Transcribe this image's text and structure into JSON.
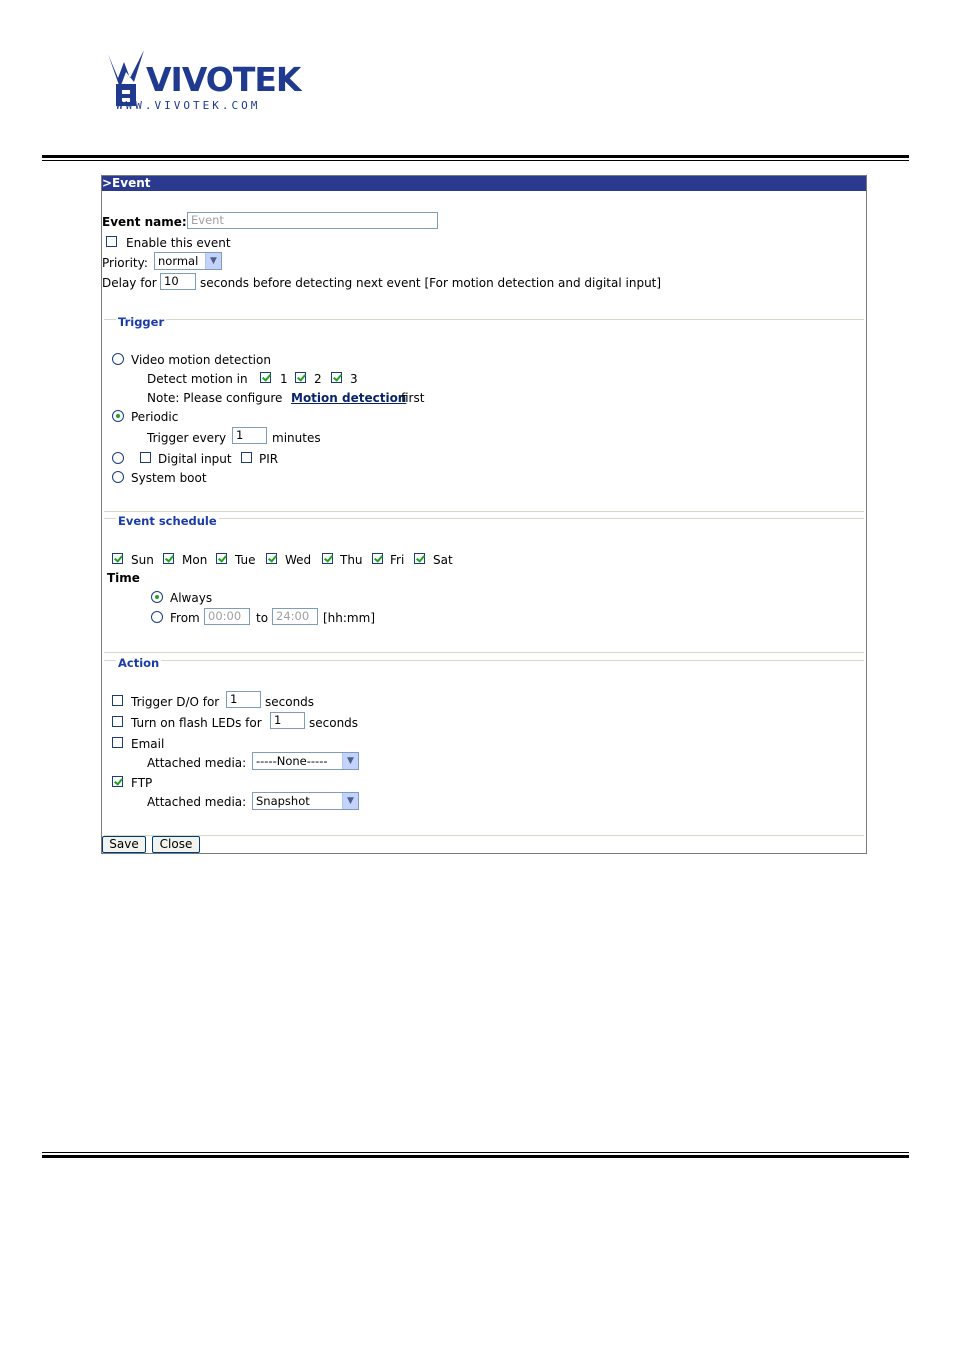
{
  "logo": {
    "brand": "VIVOTEK",
    "url": "WWW.VIVOTEK.COM"
  },
  "panel": {
    "title": ">Event",
    "event_name": {
      "label": "Event name:",
      "value": "Event"
    },
    "enable": {
      "label": "Enable this event",
      "checked": false
    },
    "priority": {
      "label": "Priority:",
      "value": "normal"
    },
    "delay": {
      "label": "Delay for",
      "value": "10",
      "suffix": "seconds before detecting next event [For motion detection and digital input]"
    }
  },
  "trigger": {
    "legend": "Trigger",
    "video_motion": {
      "label": "Video motion detection",
      "selected": false
    },
    "detect_label": "Detect motion in",
    "windows": [
      {
        "label": "1",
        "checked": true
      },
      {
        "label": "2",
        "checked": true
      },
      {
        "label": "3",
        "checked": true
      }
    ],
    "note_prefix": "Note: Please configure",
    "note_link": "Motion detection",
    "note_suffix": "first",
    "periodic": {
      "label": "Periodic",
      "selected": true
    },
    "trigger_every_label": "Trigger every",
    "trigger_every_value": "1",
    "minutes_label": "minutes",
    "digital_input": {
      "label": "Digital input",
      "checked": false
    },
    "pir": {
      "label": "PIR",
      "checked": false
    },
    "system_boot": {
      "label": "System boot",
      "selected": false
    }
  },
  "schedule": {
    "legend": "Event schedule",
    "days": [
      {
        "label": "Sun",
        "checked": true
      },
      {
        "label": "Mon",
        "checked": true
      },
      {
        "label": "Tue",
        "checked": true
      },
      {
        "label": "Wed",
        "checked": true
      },
      {
        "label": "Thu",
        "checked": true
      },
      {
        "label": "Fri",
        "checked": true
      },
      {
        "label": "Sat",
        "checked": true
      }
    ],
    "time_label": "Time",
    "always_label": "Always",
    "from_label": "From",
    "from_value": "00:00",
    "to_label": "to",
    "to_value": "24:00",
    "format_hint": "[hh:mm]"
  },
  "action": {
    "legend": "Action",
    "trigger_do": {
      "label": "Trigger D/O for",
      "value": "1",
      "suffix": "seconds",
      "checked": false
    },
    "flash_leds": {
      "label": "Turn on flash LEDs for",
      "value": "1",
      "suffix": "seconds",
      "checked": false
    },
    "email": {
      "label": "Email",
      "checked": false,
      "media_label": "Attached media:",
      "media_value": "-----None-----"
    },
    "ftp": {
      "label": "FTP",
      "checked": true,
      "media_label": "Attached media:",
      "media_value": "Snapshot"
    }
  },
  "buttons": {
    "save": "Save",
    "close": "Close"
  },
  "colors": {
    "header_bg": "#2b3a8f",
    "legend": "#1b3ca8",
    "brand": "#1f3a8f",
    "check": "#21a121"
  }
}
